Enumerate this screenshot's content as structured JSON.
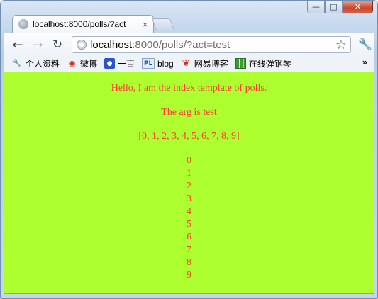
{
  "window": {
    "controls": {
      "minimize": "—",
      "maximize": "□",
      "close": "✕"
    }
  },
  "tab": {
    "title": "localhost:8000/polls/?act",
    "close": "×"
  },
  "toolbar": {
    "back": "←",
    "forward": "→",
    "reload": "↻",
    "url_host": "localhost",
    "url_path": ":8000/polls/?act=test",
    "star": "☆",
    "menu": "🔧"
  },
  "bookmarks": {
    "items": [
      {
        "label": "个人资料",
        "icon": "wrench-icon",
        "glyph": "🔧"
      },
      {
        "label": "微博",
        "icon": "weibo-icon",
        "glyph": "◉"
      },
      {
        "label": "一百",
        "icon": "paw-icon",
        "glyph": "🐾"
      },
      {
        "label": "blog",
        "icon": "pl-icon",
        "glyph": "PL"
      },
      {
        "label": "网易博客",
        "icon": "netease-icon",
        "glyph": "❦"
      },
      {
        "label": "在线弹钢琴",
        "icon": "piano-icon",
        "glyph": ""
      }
    ],
    "more": "»"
  },
  "page": {
    "background": "#adff2f",
    "text_color": "#ff3b30",
    "greeting": "Hello, I am the index template of polls.",
    "arg_line": "The arg is test",
    "list_repr": "[0, 1, 2, 3, 4, 5, 6, 7, 8, 9]",
    "numbers": [
      "0",
      "1",
      "2",
      "3",
      "4",
      "5",
      "6",
      "7",
      "8",
      "9"
    ]
  }
}
